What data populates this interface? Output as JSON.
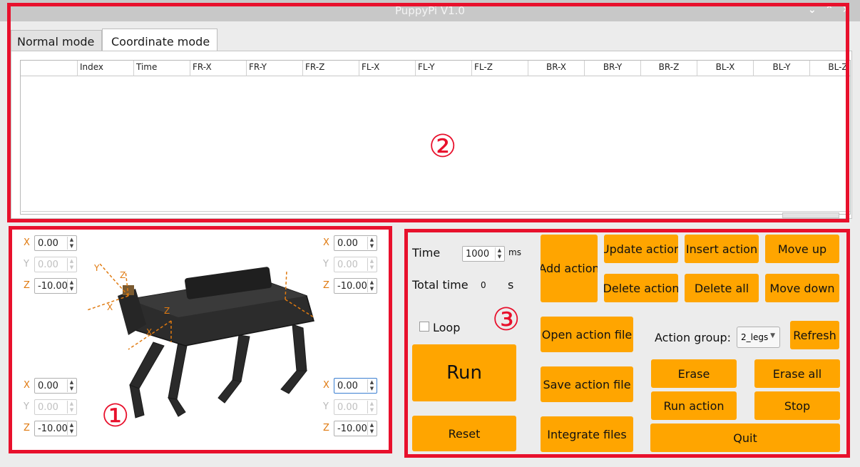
{
  "window": {
    "title": "PuppyPi V1.0",
    "controls": [
      "⌄",
      "⌃",
      "✕"
    ]
  },
  "tabs": [
    {
      "label": "Normal mode",
      "active": false
    },
    {
      "label": "Coordinate mode",
      "active": true
    }
  ],
  "table": {
    "columns": [
      "",
      "Index",
      "Time",
      "FR-X",
      "FR-Y",
      "FR-Z",
      "FL-X",
      "FL-Y",
      "FL-Z",
      "BR-X",
      "BR-Y",
      "BR-Z",
      "BL-X",
      "BL-Y",
      "BL-Z"
    ],
    "rows": []
  },
  "legs": {
    "top_left": {
      "x": {
        "label": "X",
        "value": "0.00"
      },
      "y": {
        "label": "Y",
        "value": "0.00"
      },
      "z": {
        "label": "Z",
        "value": "-10.00"
      }
    },
    "top_right": {
      "x": {
        "label": "X",
        "value": "0.00"
      },
      "y": {
        "label": "Y",
        "value": "0.00"
      },
      "z": {
        "label": "Z",
        "value": "-10.00"
      }
    },
    "bottom_left": {
      "x": {
        "label": "X",
        "value": "0.00"
      },
      "y": {
        "label": "Y",
        "value": "0.00"
      },
      "z": {
        "label": "Z",
        "value": "-10.00"
      }
    },
    "bottom_right": {
      "x": {
        "label": "X",
        "value": "0.00"
      },
      "y": {
        "label": "Y",
        "value": "0.00"
      },
      "z": {
        "label": "Z",
        "value": "-10.00"
      }
    }
  },
  "robot_axes": [
    "X",
    "Y",
    "Z"
  ],
  "controls": {
    "time_label": "Time",
    "time_value": "1000",
    "time_unit": "ms",
    "total_time_label": "Total time",
    "total_time_value": "0",
    "total_time_unit": "s",
    "loop_label": "Loop",
    "loop_checked": false,
    "run": "Run",
    "reset": "Reset",
    "add_action": "Add action",
    "update_action": "Update action",
    "insert_action": "Insert action",
    "move_up": "Move up",
    "delete_action": "Delete action",
    "delete_all": "Delete all",
    "move_down": "Move down",
    "open_action_file": "Open action file",
    "save_action_file": "Save action file",
    "integrate_files": "Integrate files",
    "action_group_label": "Action group:",
    "action_group_value": "2_legs",
    "refresh": "Refresh",
    "erase": "Erase",
    "erase_all": "Erase all",
    "run_action": "Run action",
    "stop": "Stop",
    "quit": "Quit"
  },
  "annotations": [
    "①",
    "②",
    "③"
  ],
  "colors": {
    "button": "#ffa500",
    "annotation": "#e8102c",
    "axis_label": "#e07a10"
  }
}
